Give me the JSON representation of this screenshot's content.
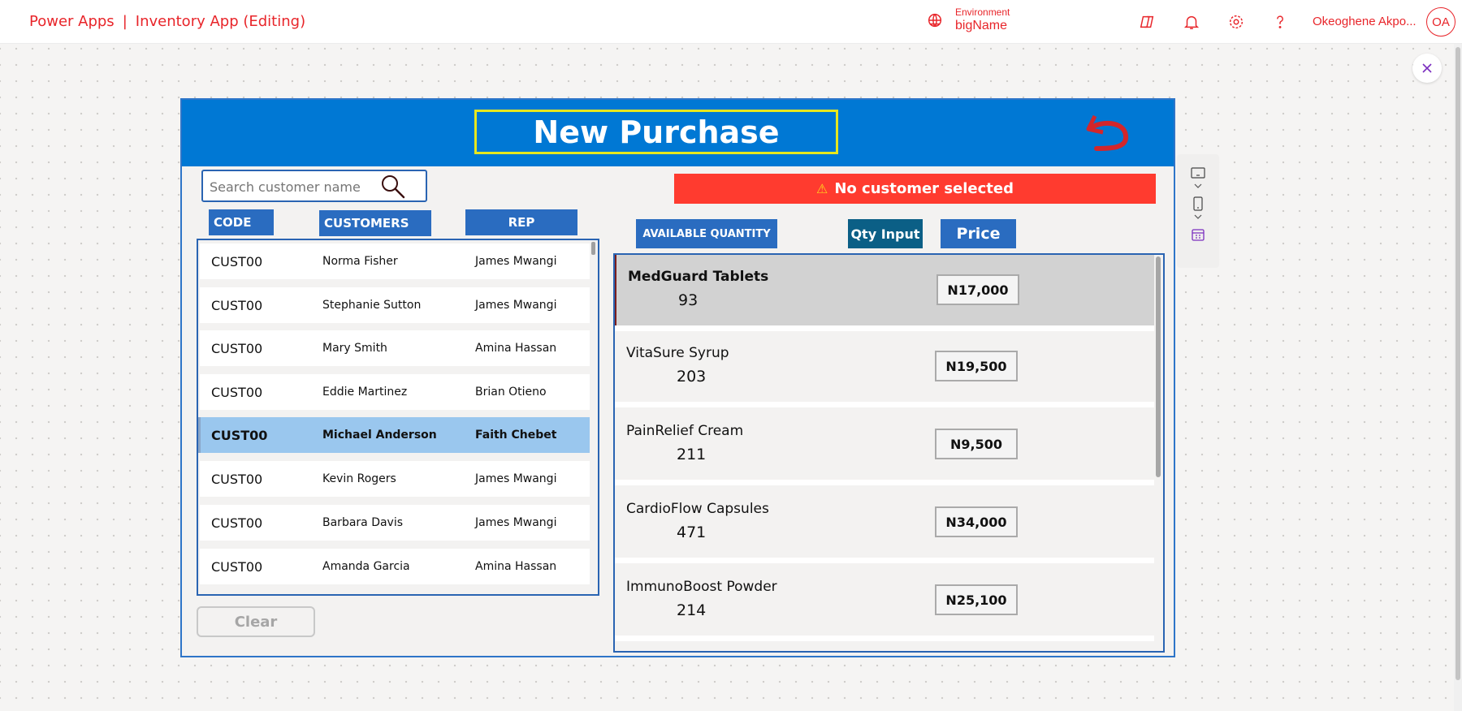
{
  "topbar": {
    "brand": "Power Apps",
    "separator": "|",
    "app_name": "Inventory App (Editing)",
    "environment_label": "Environment",
    "environment_name": "bigName",
    "user_name": "Okeoghene Akpo...",
    "user_initials": "OA",
    "accent_color": "#e8252a"
  },
  "icons": {
    "environment": "globe-icon",
    "copilot": "copilot-icon",
    "notifications": "bell-icon",
    "settings": "gear-icon",
    "help": "help-icon",
    "close": "close-icon",
    "back": "undo-icon",
    "search": "search-icon"
  },
  "screen": {
    "title": "New Purchase",
    "search_placeholder": "Search customer name",
    "alert_text": "No customer selected",
    "clear_label": "Clear"
  },
  "customer_headers": {
    "code": "CODE",
    "customers": "CUSTOMERS",
    "rep": "REP"
  },
  "customers": [
    {
      "code": "CUST00",
      "name": "Norma Fisher",
      "rep": "James Mwangi"
    },
    {
      "code": "CUST00",
      "name": "Stephanie Sutton",
      "rep": "James Mwangi"
    },
    {
      "code": "CUST00",
      "name": "Mary Smith",
      "rep": "Amina Hassan"
    },
    {
      "code": "CUST00",
      "name": "Eddie Martinez",
      "rep": "Brian Otieno"
    },
    {
      "code": "CUST00",
      "name": "Michael Anderson",
      "rep": "Faith Chebet",
      "selected": true
    },
    {
      "code": "CUST00",
      "name": "Kevin Rogers",
      "rep": "James Mwangi"
    },
    {
      "code": "CUST00",
      "name": "Barbara Davis",
      "rep": "James Mwangi"
    },
    {
      "code": "CUST00",
      "name": "Amanda Garcia",
      "rep": "Amina Hassan"
    }
  ],
  "product_headers": {
    "available_quantity": "AVAILABLE QUANTITY",
    "qty_input": "Qty Input",
    "price": "Price"
  },
  "products": [
    {
      "name": "MedGuard Tablets",
      "qty": "93",
      "price": "N17,000",
      "selected": true
    },
    {
      "name": "VitaSure Syrup",
      "qty": "203",
      "price": "N19,500"
    },
    {
      "name": "PainRelief Cream",
      "qty": "211",
      "price": "N9,500"
    },
    {
      "name": "CardioFlow Capsules",
      "qty": "471",
      "price": "N34,000"
    },
    {
      "name": "ImmunoBoost Powder",
      "qty": "214",
      "price": "N25,100"
    }
  ],
  "colors": {
    "header_blue": "#0078d4",
    "column_blue": "#2a6cc0",
    "qty_input_teal": "#0b5f86",
    "alert_red": "#ff3b2f",
    "title_border_yellow": "#e7e71d",
    "selected_row": "#9ac7ee"
  }
}
